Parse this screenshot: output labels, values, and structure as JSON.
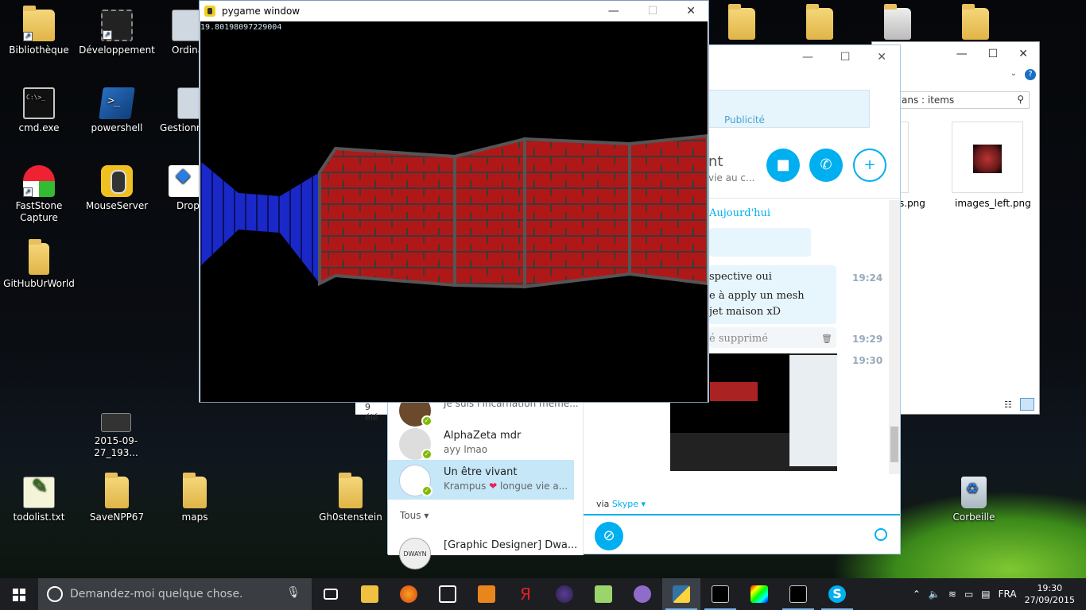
{
  "desktop": {
    "icons": [
      {
        "label": "Bibliothèque",
        "icon": "library-folder-icon"
      },
      {
        "label": "Développement",
        "icon": "chip-shortcut-icon"
      },
      {
        "label": "Ordina",
        "icon": "computer-icon"
      },
      {
        "label": "cmd.exe",
        "icon": "cmd-icon"
      },
      {
        "label": "powershell",
        "icon": "powershell-icon"
      },
      {
        "label": "Gestionna tâch",
        "icon": "task-manager-icon"
      },
      {
        "label": "FastStone Capture",
        "icon": "faststone-icon"
      },
      {
        "label": "MouseServer",
        "icon": "mouse-server-icon"
      },
      {
        "label": "Dropb",
        "icon": "dropbox-icon"
      },
      {
        "label": "GitHubUrWorld",
        "icon": "folder-icon"
      },
      {
        "label": "2015-09-27_193...",
        "icon": "screenshot-file-icon"
      },
      {
        "label": "todolist.txt",
        "icon": "notepad-icon"
      },
      {
        "label": "SaveNPP67",
        "icon": "folder-icon"
      },
      {
        "label": "maps",
        "icon": "folder-icon"
      },
      {
        "label": "Gh0stenstein",
        "icon": "folder-icon"
      },
      {
        "label": "Corbeille",
        "icon": "recycle-bin-icon"
      }
    ],
    "partial_item_count": "9 élé"
  },
  "pygame_window": {
    "title": "pygame window",
    "fps_readout": "19.80198097229004"
  },
  "explorer_window": {
    "search_placeholder": "ans : items",
    "files": [
      {
        "name": "s.png"
      },
      {
        "name": "images_left.png"
      }
    ]
  },
  "skype_window": {
    "ad_label": "Publicité",
    "contact_name_partial": "nt",
    "contact_status_partial": "vie au c...",
    "date_header": "Aujourd'hui",
    "messages": [
      {
        "lines": [
          "spective oui"
        ],
        "time": "19:24"
      },
      {
        "lines": [
          "e à apply un mesh",
          "jet maison xD"
        ],
        "time": ""
      },
      {
        "lines": [
          "é supprimé"
        ],
        "time": "19:29"
      },
      {
        "lines": [],
        "time": "19:30"
      }
    ],
    "via_prefix": "via",
    "via_link": "Skype",
    "contacts": [
      {
        "name": "",
        "message": "Je suis l'incarnation même..."
      },
      {
        "name": "AlphaZeta mdr",
        "message": "ayy lmao"
      },
      {
        "name": "Un être vivant",
        "message_prefix": "Krampus",
        "message_suffix": "longue vie a..."
      },
      {
        "name": "[Graphic Designer] Dwa...",
        "message": "",
        "avatar_text": "DWAYN"
      }
    ],
    "section_label": "Tous",
    "accent": "#00aff0"
  },
  "taskbar": {
    "search_placeholder": "Demandez-moi quelque chose.",
    "language": "FRA",
    "time": "19:30",
    "date": "27/09/2015"
  }
}
